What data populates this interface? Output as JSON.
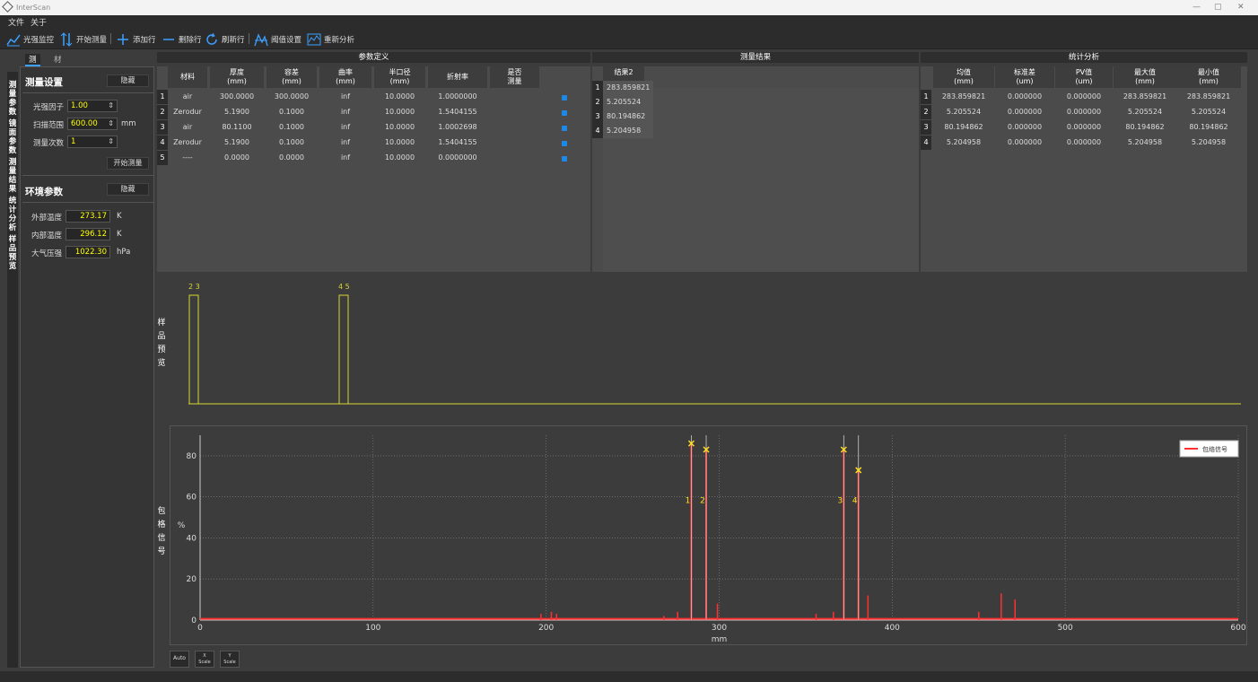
{
  "window": {
    "title": "InterScan",
    "controls": [
      "—",
      "▢",
      "✕"
    ]
  },
  "menu": [
    "文件",
    "关于"
  ],
  "toolbar": {
    "items": [
      "光强监控",
      "开始测量",
      "添加行",
      "删除行",
      "刷新行",
      "阈值设置",
      "重新分析"
    ]
  },
  "tabs": [
    "测量",
    "材料库"
  ],
  "left_tabs": [
    "测量参数",
    "镜面参数",
    "测量结果",
    "统计分析",
    "样品预览"
  ],
  "settings": {
    "title": "测量设置",
    "hide": "隐藏",
    "fields": [
      {
        "label": "光强因子",
        "value": "1.00",
        "unit": ""
      },
      {
        "label": "扫描范围",
        "value": "600.00",
        "unit": "mm"
      },
      {
        "label": "测量次数",
        "value": "1",
        "unit": ""
      }
    ],
    "start": "开始测量"
  },
  "env": {
    "title": "环境参数",
    "hide": "隐藏",
    "fields": [
      {
        "label": "外部温度",
        "value": "273.17",
        "unit": "K"
      },
      {
        "label": "内部温度",
        "value": "296.12",
        "unit": "K"
      },
      {
        "label": "大气压强",
        "value": "1022.30",
        "unit": "hPa"
      }
    ]
  },
  "param_table": {
    "title": "参数定义",
    "headers": [
      [
        "材料",
        ""
      ],
      [
        "厚度",
        "(mm)"
      ],
      [
        "容差",
        "(mm)"
      ],
      [
        "曲率",
        "(mm)"
      ],
      [
        "半口径",
        "(mm)"
      ],
      [
        "折射率",
        ""
      ],
      [
        "是否",
        "测量"
      ]
    ],
    "rows": [
      [
        "air",
        "300.0000",
        "300.0000",
        "inf",
        "10.0000",
        "1.0000000"
      ],
      [
        "Zerodur",
        "5.1900",
        "0.1000",
        "inf",
        "10.0000",
        "1.5404155"
      ],
      [
        "air",
        "80.1100",
        "0.1000",
        "inf",
        "10.0000",
        "1.0002698"
      ],
      [
        "Zerodur",
        "5.1900",
        "0.1000",
        "inf",
        "10.0000",
        "1.5404155"
      ],
      [
        "----",
        "0.0000",
        "0.0000",
        "inf",
        "10.0000",
        "0.0000000"
      ]
    ],
    "row_numbers": [
      "1",
      "2",
      "3",
      "4",
      "5"
    ]
  },
  "result_table": {
    "title": "测量结果",
    "header": "结果2",
    "values": [
      "283.859821",
      "5.205524",
      "80.194862",
      "5.204958"
    ],
    "row_numbers": [
      "1",
      "2",
      "3",
      "4"
    ]
  },
  "stats_table": {
    "title": "统计分析",
    "headers": [
      [
        "均值",
        "(mm)"
      ],
      [
        "标准差",
        "(um)"
      ],
      [
        "PV值",
        "(um)"
      ],
      [
        "最大值",
        "(mm)"
      ],
      [
        "最小值",
        "(mm)"
      ]
    ],
    "rows": [
      [
        "283.859821",
        "0.000000",
        "0.000000",
        "283.859821",
        "283.859821"
      ],
      [
        "5.205524",
        "0.000000",
        "0.000000",
        "5.205524",
        "5.205524"
      ],
      [
        "80.194862",
        "0.000000",
        "0.000000",
        "80.194862",
        "80.194862"
      ],
      [
        "5.204958",
        "0.000000",
        "0.000000",
        "5.204958",
        "5.204958"
      ]
    ],
    "row_numbers": [
      "1",
      "2",
      "3",
      "4"
    ]
  },
  "preview": {
    "side_label": "样品预览",
    "markers": [
      "2 3",
      "4 5"
    ]
  },
  "chart_side_label": "包格信号",
  "chart_data": {
    "type": "line",
    "xlabel": "mm",
    "ylabel": "%",
    "xlim": [
      0,
      600
    ],
    "ylim": [
      0,
      90
    ],
    "xticks": [
      "0",
      "100",
      "200",
      "300",
      "400",
      "500",
      "600"
    ],
    "yticks": [
      "0",
      "20",
      "40",
      "60",
      "80"
    ],
    "legend": "包络信号",
    "legend_position": "top-right",
    "series": [
      {
        "name": "包络信号",
        "color": "#ff3030",
        "peaks": [
          {
            "x": 283.9,
            "y": 86
          },
          {
            "x": 292.5,
            "y": 83
          },
          {
            "x": 372.0,
            "y": 83
          },
          {
            "x": 380.5,
            "y": 73
          },
          {
            "x": 299,
            "y": 8
          },
          {
            "x": 386,
            "y": 12
          },
          {
            "x": 463,
            "y": 13
          },
          {
            "x": 471,
            "y": 10
          },
          {
            "x": 450,
            "y": 4
          },
          {
            "x": 356,
            "y": 3
          },
          {
            "x": 366,
            "y": 4
          },
          {
            "x": 276,
            "y": 4
          },
          {
            "x": 268,
            "y": 2
          },
          {
            "x": 197,
            "y": 3
          },
          {
            "x": 203,
            "y": 4
          },
          {
            "x": 206,
            "y": 3
          }
        ]
      }
    ],
    "markers": [
      {
        "x": 283.9,
        "y": 86,
        "label": "1"
      },
      {
        "x": 292.5,
        "y": 83,
        "label": "2"
      },
      {
        "x": 372.0,
        "y": 83,
        "label": "3"
      },
      {
        "x": 380.5,
        "y": 73,
        "label": "4"
      }
    ]
  },
  "chart_buttons": [
    "Auto",
    "X\nScale",
    "Y\nScale"
  ]
}
